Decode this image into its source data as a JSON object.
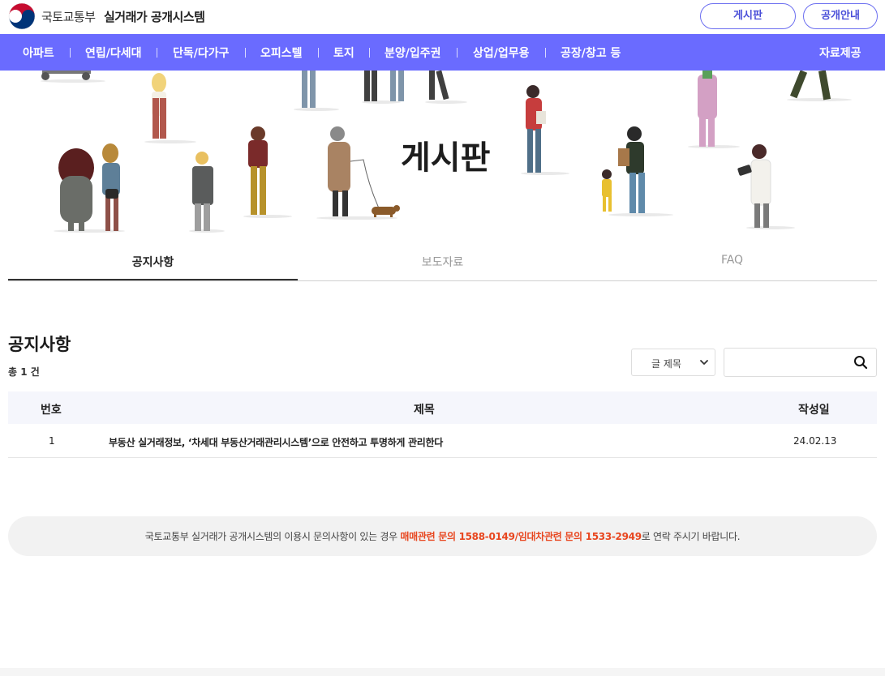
{
  "header": {
    "ministry": "국토교통부",
    "system_name": "실거래가 공개시스템",
    "buttons": {
      "board": "게시판",
      "info": "공개안내"
    }
  },
  "nav": {
    "items": [
      "아파트",
      "연립/다세대",
      "단독/다가구",
      "오피스텔",
      "토지",
      "분양/입주권",
      "상업/업무용",
      "공장/창고 등"
    ],
    "right": "자료제공"
  },
  "hero": {
    "title": "게시판"
  },
  "tabs": [
    {
      "label": "공지사항",
      "active": true
    },
    {
      "label": "보도자료",
      "active": false
    },
    {
      "label": "FAQ",
      "active": false
    }
  ],
  "section": {
    "title": "공지사항",
    "count": "총 1 건"
  },
  "search": {
    "select_value": "글 제목",
    "placeholder": ""
  },
  "table": {
    "headers": {
      "no": "번호",
      "title": "제목",
      "date": "작성일"
    },
    "rows": [
      {
        "no": "1",
        "title": "부동산 실거래정보, ‘차세대 부동산거래관리시스템’으로 안전하고 투명하게 관리한다",
        "date": "24.02.13"
      }
    ]
  },
  "notice": {
    "prefix": "국토교통부 실거래가 공개시스템의 이용시 문의사항이 있는 경우 ",
    "highlight": "매매관련 문의 1588-0149/임대차관련 문의 1533-2949",
    "suffix": "로 연락 주시기 바랍니다."
  },
  "colors": {
    "brand": "#6a6bff",
    "highlight": "#e8461f",
    "pill": "#4a4fd8"
  }
}
